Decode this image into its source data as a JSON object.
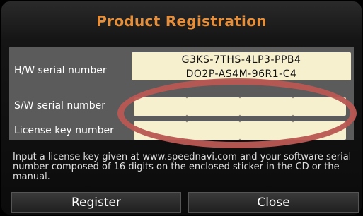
{
  "dialog": {
    "title": "Product Registration",
    "hw_label": "H/W serial number",
    "hw_serial_line1": "G3KS-7THS-4LP3-PPB4",
    "hw_serial_line2": "DO2P-AS4M-96R1-C4",
    "sw_label": "S/W serial number",
    "license_label": "License key number",
    "help_text": "Input a license key given at www.speednavi.com and your software serial number composed of 16 digits on the enclosed sticker in the CD or the manual.",
    "register_label": "Register",
    "close_label": "Close"
  },
  "sw_serial_segments": [
    "",
    "",
    "",
    ""
  ],
  "license_key_segments": [
    "",
    "",
    "",
    ""
  ],
  "colors": {
    "title": "#e58f3c",
    "panel": "#5b5b5b",
    "field": "#f6f0cf",
    "highlight_ellipse": "#b95853"
  }
}
